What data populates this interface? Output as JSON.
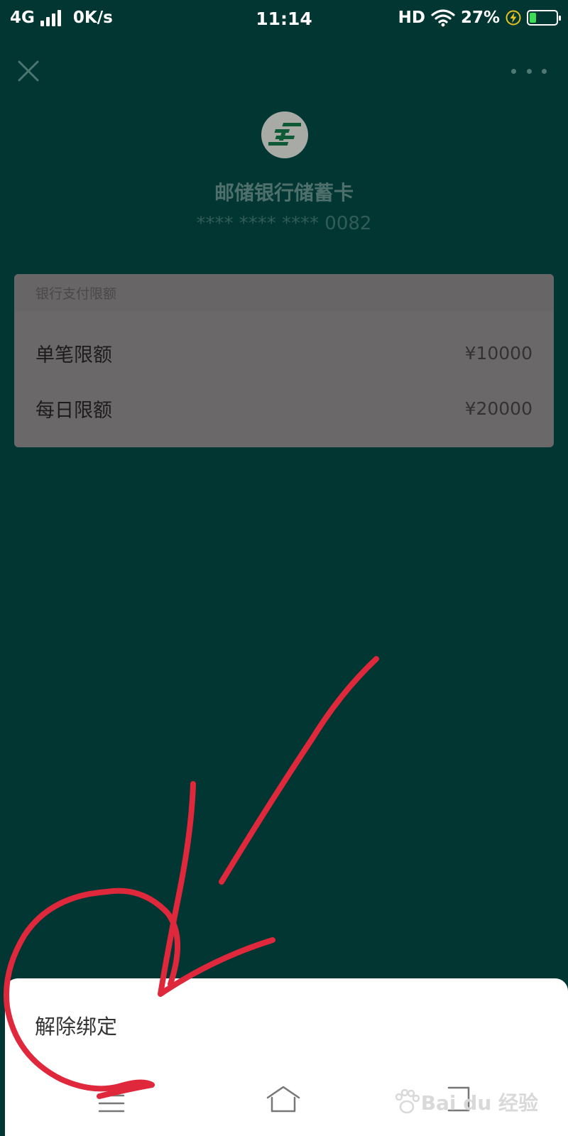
{
  "status_bar": {
    "network": "4G",
    "speed": "0K/s",
    "time": "11:14",
    "hd": "HD",
    "battery": "27%",
    "battery_fraction": 0.27
  },
  "icons": {
    "close": "close-icon",
    "more": "more-icon",
    "bank_logo": "postal-savings-bank-logo",
    "menu": "menu-icon",
    "home": "home-icon",
    "back": "back-icon"
  },
  "card": {
    "bank_name": "邮储银行储蓄卡",
    "masked_number": "**** **** **** 0082"
  },
  "limits": {
    "header": "银行支付限额",
    "rows": [
      {
        "label": "单笔限额",
        "value": "¥10000"
      },
      {
        "label": "每日限额",
        "value": "¥20000"
      }
    ]
  },
  "sheet": {
    "unbind_label": "解除绑定"
  },
  "watermark": {
    "text": "Bai du 经验",
    "url": "jingyan.baidu.com"
  },
  "colors": {
    "background": "#023632",
    "annotation": "#e0283c",
    "card": "#6b6869"
  }
}
